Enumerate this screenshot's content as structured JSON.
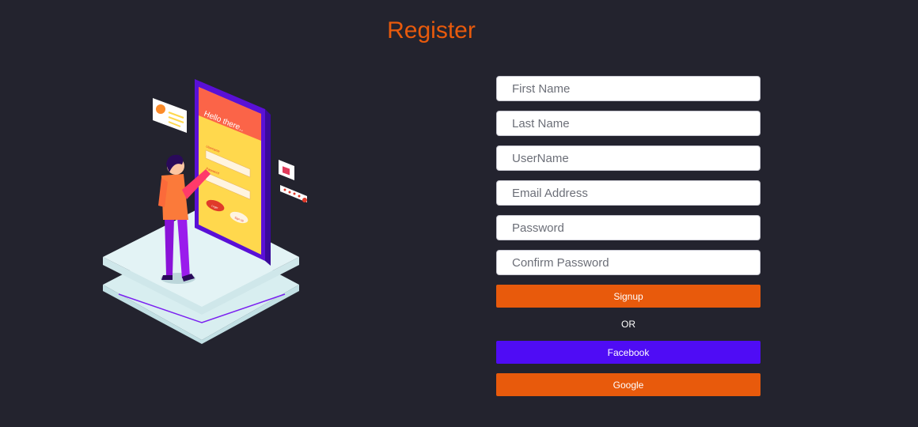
{
  "page": {
    "title": "Register"
  },
  "form": {
    "first_name": {
      "placeholder": "First Name",
      "value": ""
    },
    "last_name": {
      "placeholder": "Last Name",
      "value": ""
    },
    "username": {
      "placeholder": "UserName",
      "value": ""
    },
    "email": {
      "placeholder": "Email Address",
      "value": ""
    },
    "password": {
      "placeholder": "Password",
      "value": ""
    },
    "confirm_password": {
      "placeholder": "Confirm Password",
      "value": ""
    },
    "signup_label": "Signup",
    "or_text": "OR",
    "facebook_label": "Facebook",
    "google_label": "Google"
  },
  "illustration": {
    "phone_greeting": "Hello there..",
    "phone_username_label": "Username",
    "phone_password_label": "Password",
    "phone_login_label": "Login",
    "phone_signup_label": "Sign Up"
  },
  "colors": {
    "background": "#23232e",
    "accent_orange": "#e85a0c",
    "facebook_purple": "#4f0cf5"
  }
}
